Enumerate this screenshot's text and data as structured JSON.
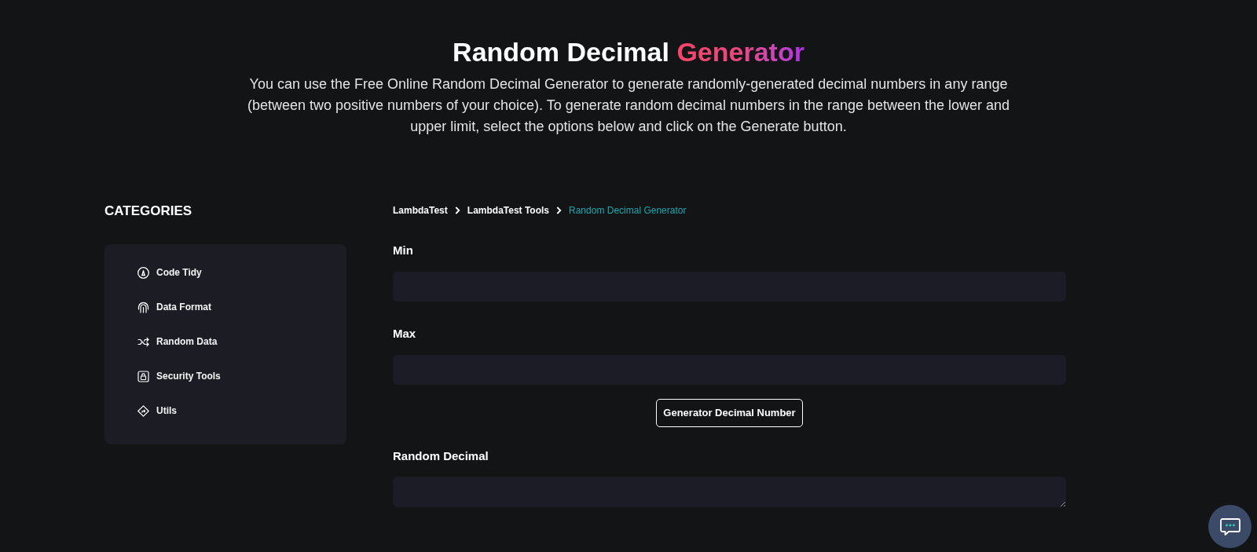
{
  "header": {
    "title": "Random Decimal",
    "title_highlight": "Generator",
    "description": "You can use the Free Online Random Decimal Generator to generate randomly-generated decimal numbers in any range (between two positive numbers of your choice). To generate random decimal numbers in the range between the lower and upper limit, select the options below and click on the Generate button."
  },
  "sidebar": {
    "heading": "CATEGORIES",
    "items": [
      {
        "label": "Code Tidy"
      },
      {
        "label": "Data Format"
      },
      {
        "label": "Random Data"
      },
      {
        "label": "Security Tools"
      },
      {
        "label": "Utils"
      }
    ]
  },
  "breadcrumb": [
    {
      "label": "LambdaTest",
      "current": false
    },
    {
      "label": "LambdaTest Tools",
      "current": false
    },
    {
      "label": "Random Decimal Generator",
      "current": true
    }
  ],
  "form": {
    "fields": [
      {
        "label": "Min"
      },
      {
        "label": "Max"
      }
    ],
    "button": "Generator Decimal Number",
    "output": {
      "label": "Random Decimal"
    }
  }
}
